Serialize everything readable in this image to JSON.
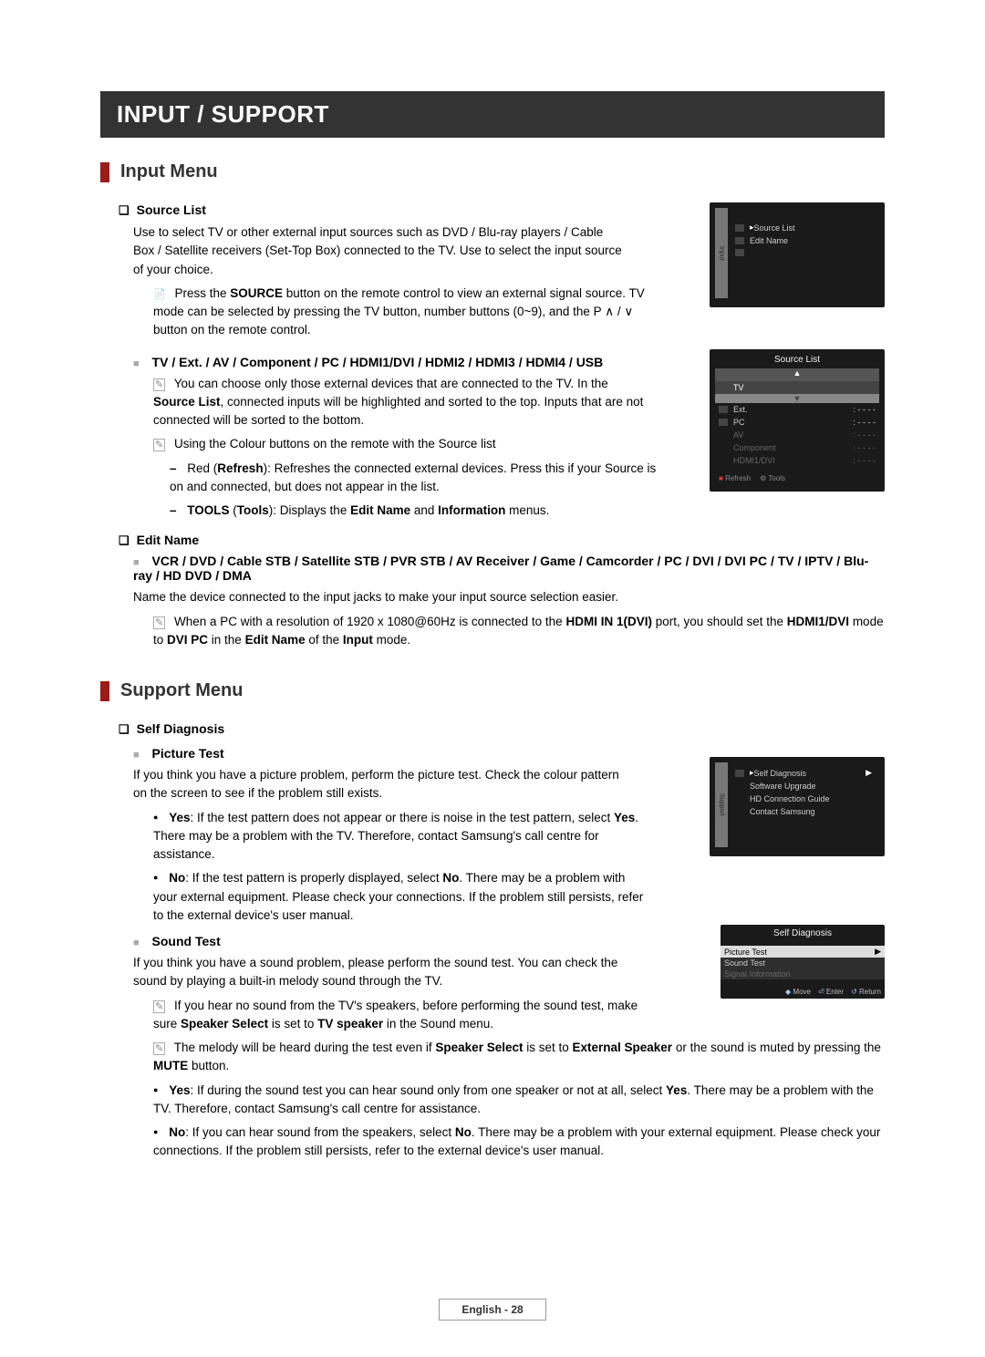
{
  "title_bar": "INPUT / SUPPORT",
  "section_input_menu": "Input Menu",
  "source_list_heading": "Source List",
  "source_list_intro": "Use to select TV or other external input sources such as DVD / Blu-ray players / Cable Box / Satellite receivers (Set-Top Box) connected to the TV. Use to select the input source of your choice.",
  "source_list_note_pre": "Press the ",
  "source_list_note_bold1": "SOURCE",
  "source_list_note_mid": " button on the remote control to view an external signal source. TV mode can be selected by pressing the TV button, number buttons (0~9), and the P ",
  "source_list_note_post": " button on the remote control.",
  "tv_ext_heading": "TV / Ext. / AV / Component / PC / HDMI1/DVI / HDMI2 / HDMI3 / HDMI4 / USB",
  "tv_ext_note_pre": "You can choose only those external devices that are connected to the TV. In the ",
  "tv_ext_note_bold": "Source List",
  "tv_ext_note_post": ", connected inputs will be highlighted and sorted to the top. Inputs that are not connected will be sorted to the bottom.",
  "colour_buttons_note": "Using the Colour buttons on the remote with the Source list",
  "red_refresh_pre": "Red (",
  "red_refresh_bold": "Refresh",
  "red_refresh_post": "): Refreshes the connected external devices. Press this if your Source is on and connected, but does not appear in the list.",
  "tools_pre": "TOOLS",
  "tools_mid": " (",
  "tools_b2": "Tools",
  "tools_mid2": "): Displays the ",
  "tools_b3": "Edit Name",
  "tools_mid3": " and ",
  "tools_b4": "Information",
  "tools_post": " menus.",
  "edit_name_heading": "Edit Name",
  "edit_name_devices": "VCR / DVD / Cable STB / Satellite STB / PVR STB / AV Receiver / Game / Camcorder / PC / DVI / DVI PC / TV / IPTV / Blu-ray / HD DVD / DMA",
  "edit_name_text": "Name the device connected to the input jacks to make your input source selection easier.",
  "edit_name_note_pre": "When a PC with a resolution of 1920 x 1080@60Hz is connected to the ",
  "edit_name_note_b1": "HDMI IN 1(DVI)",
  "edit_name_note_mid1": " port, you should set the ",
  "edit_name_note_b2": "HDMI1/DVI",
  "edit_name_note_mid2": " mode to ",
  "edit_name_note_b3": "DVI PC",
  "edit_name_note_mid3": " in the ",
  "edit_name_note_b4": "Edit Name",
  "edit_name_note_mid4": " of the ",
  "edit_name_note_b5": "Input",
  "edit_name_note_post": " mode.",
  "section_support_menu": "Support Menu",
  "self_diagnosis_heading": "Self Diagnosis",
  "picture_test_heading": "Picture Test",
  "picture_test_intro": "If you think you have a picture problem, perform the picture test. Check the colour pattern on the screen to see if the problem still exists.",
  "yes_label": "Yes",
  "picture_test_yes": ": If the test pattern does not appear or there is noise in the test pattern, select ",
  "picture_test_yes_b2": "Yes",
  "picture_test_yes_post": ". There may be a problem with the TV. Therefore, contact Samsung's call centre for assistance.",
  "no_label": "No",
  "picture_test_no": ": If the test pattern is properly displayed, select ",
  "picture_test_no_b2": "No",
  "picture_test_no_post": ". There may be a problem with your external equipment. Please check your connections. If the problem still persists, refer to the external device's user manual.",
  "sound_test_heading": "Sound Test",
  "sound_test_intro": "If you think you have a sound problem, please perform the sound test. You can check the sound by playing a built-in melody sound through the TV.",
  "sound_test_note1_pre": "If you hear no sound from the TV's speakers, before performing the sound test, make sure ",
  "sound_test_note1_b1": "Speaker Select",
  "sound_test_note1_mid": " is set to ",
  "sound_test_note1_b2": "TV speaker",
  "sound_test_note1_post": " in the Sound menu.",
  "sound_test_note2_pre": "The melody will be heard during the test even if ",
  "sound_test_note2_b1": "Speaker Select",
  "sound_test_note2_mid": " is set to ",
  "sound_test_note2_b2": "External Speaker",
  "sound_test_note2_mid2": " or the sound is muted by pressing the ",
  "sound_test_note2_b3": "MUTE",
  "sound_test_note2_post": " button.",
  "sound_test_yes_pre": ": If during the sound test you can hear sound only from one speaker or not at all, select ",
  "sound_test_yes_b2": "Yes",
  "sound_test_yes_post": ". There may be a problem with the TV. Therefore, contact Samsung's call centre for assistance.",
  "sound_test_no_pre": ": If you can hear sound from the speakers, select ",
  "sound_test_no_b2": "No",
  "sound_test_no_post": ". There may be a problem with your external equipment. Please check your connections. If the problem still persists, refer to the external device's user manual.",
  "fig1": {
    "side": "Input",
    "line1": "Source List",
    "line2": "Edit Name"
  },
  "fig2": {
    "title": "Source List",
    "row_tv": "TV",
    "row_ext": "Ext.",
    "row_pc": "PC",
    "row_av": "AV",
    "row_comp": "Component",
    "row_hdmi": "HDMI1/DVI",
    "dashes": ": - - - -",
    "ftr_refresh": "Refresh",
    "ftr_tools": "Tools"
  },
  "fig3": {
    "side": "Support",
    "line1": "Self Diagnosis",
    "line2": "Software Upgrade",
    "line3": "HD Connection Guide",
    "line4": "Contact Samsung"
  },
  "fig4": {
    "title": "Self Diagnosis",
    "row1": "Picture Test",
    "row2": "Sound Test",
    "row3": "Signal Information",
    "f_move": "Move",
    "f_enter": "Enter",
    "f_return": "Return"
  },
  "footer_text": "English - 28"
}
